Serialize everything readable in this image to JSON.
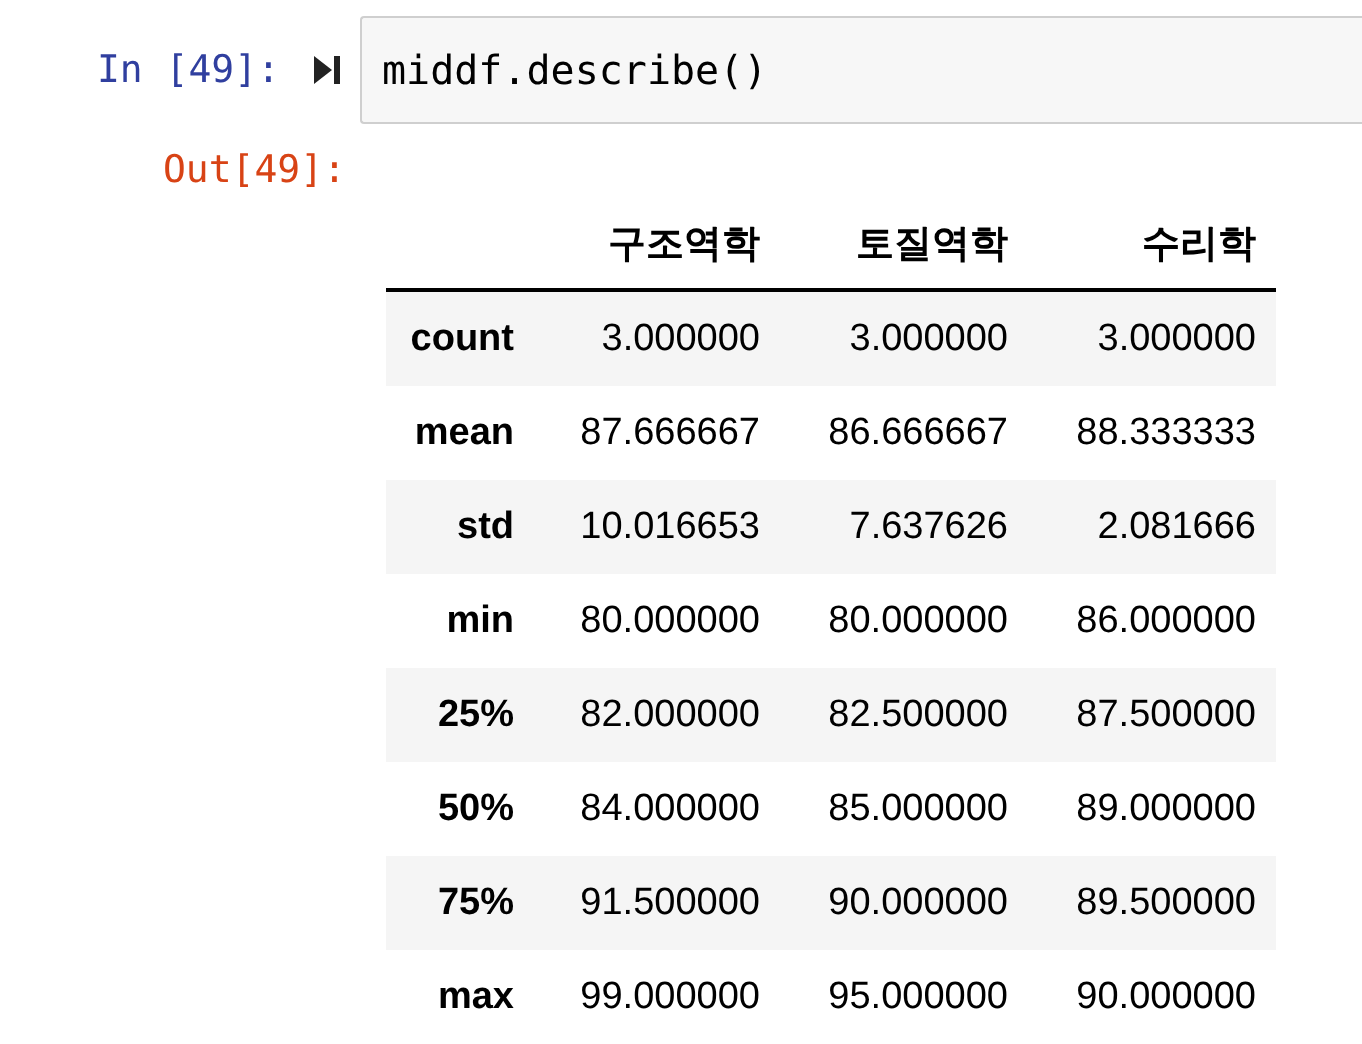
{
  "input_cell": {
    "prompt": "In [49]:",
    "code": "middf.describe()"
  },
  "output_cell": {
    "prompt": "Out[49]:"
  },
  "table": {
    "columns": [
      "구조역학",
      "토질역학",
      "수리학"
    ],
    "rows": [
      {
        "index": "count",
        "values": [
          "3.000000",
          "3.000000",
          "3.000000"
        ]
      },
      {
        "index": "mean",
        "values": [
          "87.666667",
          "86.666667",
          "88.333333"
        ]
      },
      {
        "index": "std",
        "values": [
          "10.016653",
          "7.637626",
          "2.081666"
        ]
      },
      {
        "index": "min",
        "values": [
          "80.000000",
          "80.000000",
          "86.000000"
        ]
      },
      {
        "index": "25%",
        "values": [
          "82.000000",
          "82.500000",
          "87.500000"
        ]
      },
      {
        "index": "50%",
        "values": [
          "84.000000",
          "85.000000",
          "89.000000"
        ]
      },
      {
        "index": "75%",
        "values": [
          "91.500000",
          "90.000000",
          "89.500000"
        ]
      },
      {
        "index": "max",
        "values": [
          "99.000000",
          "95.000000",
          "90.000000"
        ]
      }
    ]
  }
}
